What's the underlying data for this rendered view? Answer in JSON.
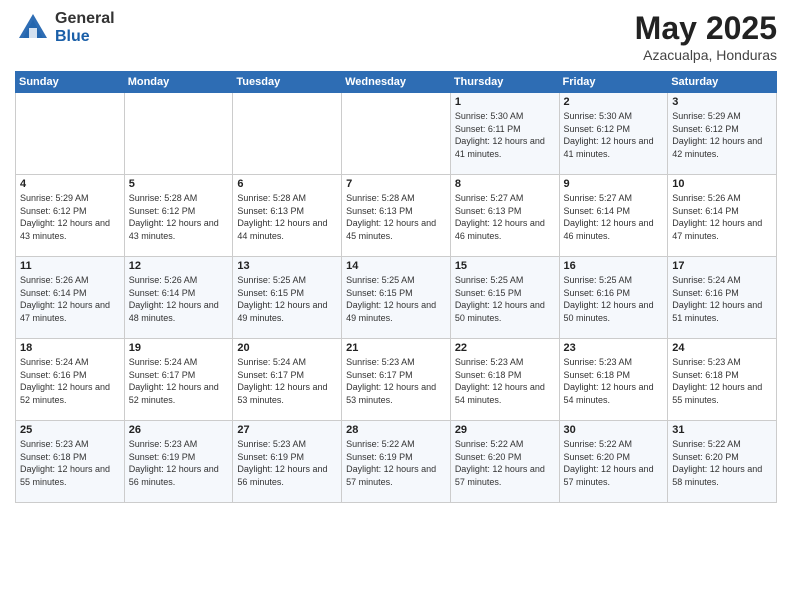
{
  "logo": {
    "general": "General",
    "blue": "Blue"
  },
  "title": "May 2025",
  "subtitle": "Azacualpa, Honduras",
  "days_of_week": [
    "Sunday",
    "Monday",
    "Tuesday",
    "Wednesday",
    "Thursday",
    "Friday",
    "Saturday"
  ],
  "weeks": [
    [
      {
        "day": "",
        "info": ""
      },
      {
        "day": "",
        "info": ""
      },
      {
        "day": "",
        "info": ""
      },
      {
        "day": "",
        "info": ""
      },
      {
        "day": "1",
        "info": "Sunrise: 5:30 AM\nSunset: 6:11 PM\nDaylight: 12 hours\nand 41 minutes."
      },
      {
        "day": "2",
        "info": "Sunrise: 5:30 AM\nSunset: 6:12 PM\nDaylight: 12 hours\nand 41 minutes."
      },
      {
        "day": "3",
        "info": "Sunrise: 5:29 AM\nSunset: 6:12 PM\nDaylight: 12 hours\nand 42 minutes."
      }
    ],
    [
      {
        "day": "4",
        "info": "Sunrise: 5:29 AM\nSunset: 6:12 PM\nDaylight: 12 hours\nand 43 minutes."
      },
      {
        "day": "5",
        "info": "Sunrise: 5:28 AM\nSunset: 6:12 PM\nDaylight: 12 hours\nand 43 minutes."
      },
      {
        "day": "6",
        "info": "Sunrise: 5:28 AM\nSunset: 6:13 PM\nDaylight: 12 hours\nand 44 minutes."
      },
      {
        "day": "7",
        "info": "Sunrise: 5:28 AM\nSunset: 6:13 PM\nDaylight: 12 hours\nand 45 minutes."
      },
      {
        "day": "8",
        "info": "Sunrise: 5:27 AM\nSunset: 6:13 PM\nDaylight: 12 hours\nand 46 minutes."
      },
      {
        "day": "9",
        "info": "Sunrise: 5:27 AM\nSunset: 6:14 PM\nDaylight: 12 hours\nand 46 minutes."
      },
      {
        "day": "10",
        "info": "Sunrise: 5:26 AM\nSunset: 6:14 PM\nDaylight: 12 hours\nand 47 minutes."
      }
    ],
    [
      {
        "day": "11",
        "info": "Sunrise: 5:26 AM\nSunset: 6:14 PM\nDaylight: 12 hours\nand 47 minutes."
      },
      {
        "day": "12",
        "info": "Sunrise: 5:26 AM\nSunset: 6:14 PM\nDaylight: 12 hours\nand 48 minutes."
      },
      {
        "day": "13",
        "info": "Sunrise: 5:25 AM\nSunset: 6:15 PM\nDaylight: 12 hours\nand 49 minutes."
      },
      {
        "day": "14",
        "info": "Sunrise: 5:25 AM\nSunset: 6:15 PM\nDaylight: 12 hours\nand 49 minutes."
      },
      {
        "day": "15",
        "info": "Sunrise: 5:25 AM\nSunset: 6:15 PM\nDaylight: 12 hours\nand 50 minutes."
      },
      {
        "day": "16",
        "info": "Sunrise: 5:25 AM\nSunset: 6:16 PM\nDaylight: 12 hours\nand 50 minutes."
      },
      {
        "day": "17",
        "info": "Sunrise: 5:24 AM\nSunset: 6:16 PM\nDaylight: 12 hours\nand 51 minutes."
      }
    ],
    [
      {
        "day": "18",
        "info": "Sunrise: 5:24 AM\nSunset: 6:16 PM\nDaylight: 12 hours\nand 52 minutes."
      },
      {
        "day": "19",
        "info": "Sunrise: 5:24 AM\nSunset: 6:17 PM\nDaylight: 12 hours\nand 52 minutes."
      },
      {
        "day": "20",
        "info": "Sunrise: 5:24 AM\nSunset: 6:17 PM\nDaylight: 12 hours\nand 53 minutes."
      },
      {
        "day": "21",
        "info": "Sunrise: 5:23 AM\nSunset: 6:17 PM\nDaylight: 12 hours\nand 53 minutes."
      },
      {
        "day": "22",
        "info": "Sunrise: 5:23 AM\nSunset: 6:18 PM\nDaylight: 12 hours\nand 54 minutes."
      },
      {
        "day": "23",
        "info": "Sunrise: 5:23 AM\nSunset: 6:18 PM\nDaylight: 12 hours\nand 54 minutes."
      },
      {
        "day": "24",
        "info": "Sunrise: 5:23 AM\nSunset: 6:18 PM\nDaylight: 12 hours\nand 55 minutes."
      }
    ],
    [
      {
        "day": "25",
        "info": "Sunrise: 5:23 AM\nSunset: 6:18 PM\nDaylight: 12 hours\nand 55 minutes."
      },
      {
        "day": "26",
        "info": "Sunrise: 5:23 AM\nSunset: 6:19 PM\nDaylight: 12 hours\nand 56 minutes."
      },
      {
        "day": "27",
        "info": "Sunrise: 5:23 AM\nSunset: 6:19 PM\nDaylight: 12 hours\nand 56 minutes."
      },
      {
        "day": "28",
        "info": "Sunrise: 5:22 AM\nSunset: 6:19 PM\nDaylight: 12 hours\nand 57 minutes."
      },
      {
        "day": "29",
        "info": "Sunrise: 5:22 AM\nSunset: 6:20 PM\nDaylight: 12 hours\nand 57 minutes."
      },
      {
        "day": "30",
        "info": "Sunrise: 5:22 AM\nSunset: 6:20 PM\nDaylight: 12 hours\nand 57 minutes."
      },
      {
        "day": "31",
        "info": "Sunrise: 5:22 AM\nSunset: 6:20 PM\nDaylight: 12 hours\nand 58 minutes."
      }
    ]
  ]
}
